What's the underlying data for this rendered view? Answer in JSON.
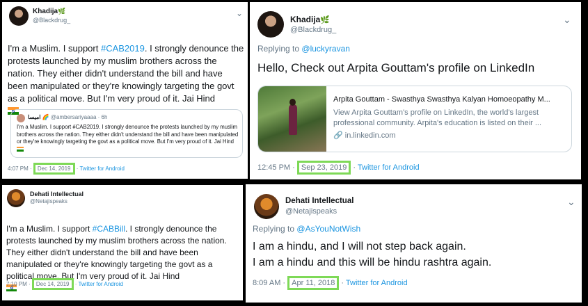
{
  "tweets": [
    {
      "name": "Khadija",
      "name_emoji": "🌿",
      "handle": "@Blackdrug_",
      "text_before": "I'm a Muslim. I support ",
      "hashtag": "#CAB2019",
      "text_after": ". I strongly denounce the protests launched by my muslim brothers across the nation. They either didn't understand the bill and have been manipulated or they're knowingly targeting the govt as a political move. But I'm very proud of it. Jai Hind",
      "quote": {
        "name": "امیسا 🌈",
        "handle": "@ambersariyaaaa · 6h",
        "text": "I'm a Muslim. I support #CAB2019. I strongly denounce the protests launched by my muslim brothers across the nation. They either didn't understand the bill and have been manipulated or they're knowingly targeting the govt as a political move. But I'm very proud of it. Jai Hind"
      },
      "time": "4:07 PM",
      "date": "Dec 14, 2019",
      "source": "Twitter for Android"
    },
    {
      "name": "Khadija",
      "name_emoji": "🌿",
      "handle": "@Blackdrug_",
      "replying_label": "Replying to",
      "replying_to": "@luckyravan",
      "text": "Hello, Check out Arpita Gouttam's profile on LinkedIn",
      "preview": {
        "title": "Arpita Gouttam - Swasthya Swasthya Kalyan Homoeopathy M...",
        "description": "View Arpita Gouttam's profile on LinkedIn, the world's largest professional community. Arpita's education is listed on their ...",
        "domain": "in.linkedin.com"
      },
      "time": "12:45 PM",
      "date": "Sep 23, 2019",
      "source": "Twitter for Android"
    },
    {
      "name": "Dehati Intellectual",
      "handle": "@Netajispeaks",
      "text_before": "I'm a Muslim. I support ",
      "hashtag": "#CABBill",
      "text_after": ". I strongly denounce the protests launched by my muslim brothers across the nation. They either didn't understand the bill and have been manipulated or they're knowingly targeting the govt as a political move. But I'm very proud of it. Jai Hind",
      "time": "7:10 PM",
      "date": "Dec 14, 2019",
      "source": "Twitter for Android"
    },
    {
      "name": "Dehati Intellectual",
      "handle": "@Netajispeaks",
      "replying_label": "Replying to",
      "replying_to": "@AsYouNotWish",
      "line1": "I am a hindu, and I will not step back again.",
      "line2": "I am a hindu and this will be hindu rashtra again.",
      "time": "8:09 AM",
      "date": "Apr 11, 2018",
      "source": "Twitter for Android"
    }
  ],
  "colors": {
    "highlight": "#7ed957",
    "link": "#1b95e0",
    "muted": "#657786",
    "divider": "#000000"
  },
  "icons": [
    "chevron-down-icon",
    "leaf-icon",
    "link-icon",
    "india-flag-icon"
  ]
}
